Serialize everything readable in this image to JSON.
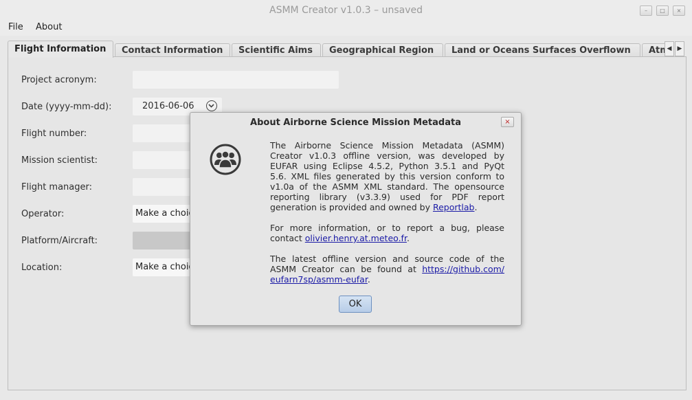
{
  "window": {
    "title": "ASMM Creator v1.0.3 – unsaved",
    "buttons": {
      "minimize": "–",
      "maximize": "□",
      "close": "×"
    }
  },
  "menu": [
    "File",
    "About"
  ],
  "tabs": [
    {
      "label": "Flight Information",
      "active": true
    },
    {
      "label": "Contact Information"
    },
    {
      "label": "Scientific Aims"
    },
    {
      "label": "Geographical Region"
    },
    {
      "label": "Land or Oceans Surfaces Overflown"
    },
    {
      "label": "Atm"
    }
  ],
  "tab_scroll": {
    "left": "◀",
    "right": "▶"
  },
  "form": {
    "project_acronym": {
      "label": "Project acronym:",
      "value": ""
    },
    "date": {
      "label": "Date (yyyy-mm-dd):",
      "value": "2016-06-06"
    },
    "flight_number": {
      "label": "Flight number:",
      "value": ""
    },
    "mission_scientist": {
      "label": "Mission scientist:",
      "value": ""
    },
    "flight_manager": {
      "label": "Flight manager:",
      "value": ""
    },
    "operator": {
      "label": "Operator:",
      "value": "Make a choice..."
    },
    "platform": {
      "label": "Platform/Aircraft:",
      "value": ""
    },
    "location": {
      "label": "Location:",
      "value": "Make a choice..."
    }
  },
  "dialog": {
    "title": "About Airborne Science Mission Metadata",
    "close": "×",
    "icon": "users-group-icon",
    "p1": [
      "The Airborne Science Mission Metadata (ASMM)",
      "Creator v1.0.3 offline version, was developed by",
      "EUFAR using Eclipse 4.5.2, Python 3.5.1 and PyQt",
      "5.6. XML files generated by this version conform to",
      "v1.0a of the ASMM XML standard. The opensource",
      "reporting library (v3.3.9) used for PDF report"
    ],
    "p1_last": "generation is provided and owned by",
    "link_reportlab": "Reportlab",
    "p2_line1": "For more information, or to report a bug, please",
    "p2_contact": "contact",
    "link_email": "olivier.henry.at.meteo.fr",
    "p3_line1": "The latest offline version and source code of the",
    "p3_line2": "ASMM Creator can be found at",
    "link_github1": "https://github.com/",
    "link_github2": "eufarn7sp/asmm-eufar",
    "period": ".",
    "ok": "OK"
  }
}
